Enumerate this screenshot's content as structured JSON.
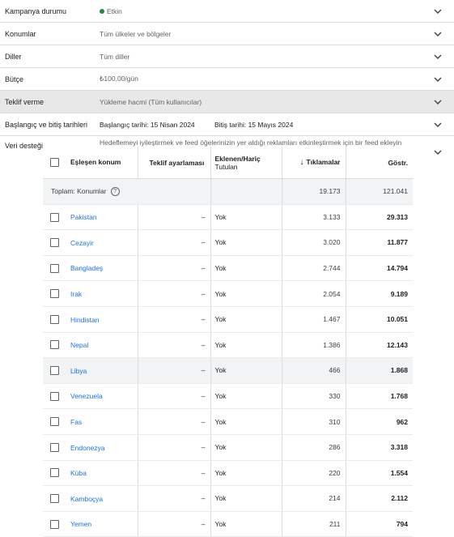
{
  "settings": [
    {
      "label": "Kampanya durumu",
      "value": "Etkin",
      "status": true
    },
    {
      "label": "Konumlar",
      "value": "Tüm ülkeler ve bölgeler"
    },
    {
      "label": "Diller",
      "value": "Tüm diller"
    },
    {
      "label": "Bütçe",
      "value": "₺100,00/gün"
    },
    {
      "label": "Teklif verme",
      "value": "Yükleme hacmi (Tüm kullanıcılar)"
    },
    {
      "label": "Başlangıç ve bitiş tarihleri",
      "start": "Başlangıç tarihi: 15 Nisan 2024",
      "end": "Bitiş tarihi: 15 Mayıs 2024"
    },
    {
      "label": "Veri desteği",
      "value": "Hedeflemeyi iyileştirmek ve feed öğelerinizin yer aldığı reklamları etkinleştirmek için bir feed ekleyin"
    }
  ],
  "table": {
    "headers": {
      "location": "Eşleşen konum",
      "bid": "Teklif ayarlaması",
      "included_1": "Eklenen/Hariç",
      "included_2": "Tutulan",
      "clicks": "Tıklamalar",
      "impr": "Göstr."
    },
    "total": {
      "label": "Toplam: Konumlar",
      "help": "?",
      "clicks": "19.173",
      "impr": "121.041"
    },
    "rows": [
      {
        "loc": "Pakistan",
        "bid": "–",
        "ex": "Yok",
        "clicks": "3.133",
        "impr": "29.313"
      },
      {
        "loc": "Cezayir",
        "bid": "–",
        "ex": "Yok",
        "clicks": "3.020",
        "impr": "11.877"
      },
      {
        "loc": "Bangladeş",
        "bid": "–",
        "ex": "Yok",
        "clicks": "2.744",
        "impr": "14.794"
      },
      {
        "loc": "Irak",
        "bid": "–",
        "ex": "Yok",
        "clicks": "2.054",
        "impr": "9.189"
      },
      {
        "loc": "Hindistan",
        "bid": "–",
        "ex": "Yok",
        "clicks": "1.467",
        "impr": "10.051"
      },
      {
        "loc": "Nepal",
        "bid": "–",
        "ex": "Yok",
        "clicks": "1.386",
        "impr": "12.143"
      },
      {
        "loc": "Libya",
        "bid": "–",
        "ex": "Yok",
        "clicks": "466",
        "impr": "1.868"
      },
      {
        "loc": "Venezuela",
        "bid": "–",
        "ex": "Yok",
        "clicks": "330",
        "impr": "1.768"
      },
      {
        "loc": "Fas",
        "bid": "–",
        "ex": "Yok",
        "clicks": "310",
        "impr": "962"
      },
      {
        "loc": "Endonezya",
        "bid": "–",
        "ex": "Yok",
        "clicks": "286",
        "impr": "3.318"
      },
      {
        "loc": "Küba",
        "bid": "–",
        "ex": "Yok",
        "clicks": "220",
        "impr": "1.554"
      },
      {
        "loc": "Kamboçya",
        "bid": "–",
        "ex": "Yok",
        "clicks": "214",
        "impr": "2.112"
      },
      {
        "loc": "Yemen",
        "bid": "–",
        "ex": "Yok",
        "clicks": "211",
        "impr": "794"
      }
    ]
  },
  "icons": {
    "chevron": "chevron-down-icon",
    "sort": "arrow-down-icon",
    "help": "help-circle-icon",
    "status": "status-dot-icon"
  },
  "colors": {
    "status_green": "#1e8e3e",
    "link_blue": "#1a73e8",
    "highlight_gray": "#e8e8e8"
  }
}
